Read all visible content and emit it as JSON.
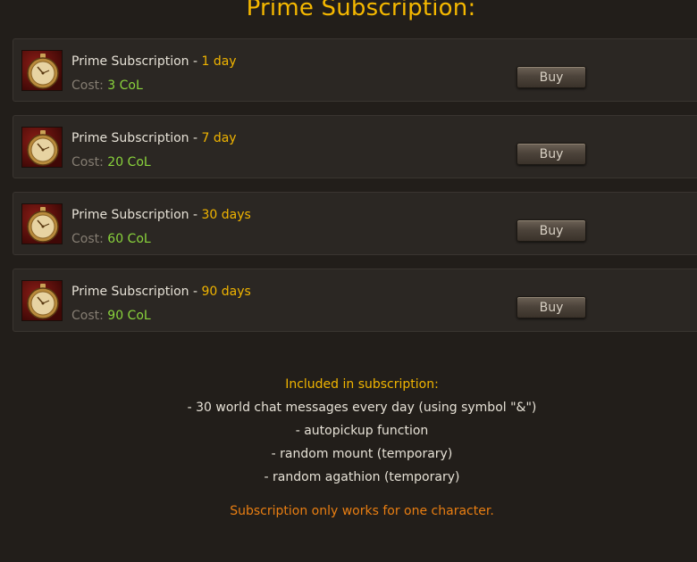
{
  "page": {
    "title": "Prime Subscription:"
  },
  "items": [
    {
      "name": "Prime Subscription - ",
      "duration": "1 day",
      "cost_label": "Cost: ",
      "cost_value": "3 CoL",
      "buy_label": "Buy",
      "icon": "pocket-watch-icon"
    },
    {
      "name": "Prime Subscription - ",
      "duration": "7 day",
      "cost_label": "Cost: ",
      "cost_value": "20 CoL",
      "buy_label": "Buy",
      "icon": "pocket-watch-icon"
    },
    {
      "name": "Prime Subscription - ",
      "duration": "30 days",
      "cost_label": "Cost: ",
      "cost_value": "60 CoL",
      "buy_label": "Buy",
      "icon": "pocket-watch-icon"
    },
    {
      "name": "Prime Subscription - ",
      "duration": "90 days",
      "cost_label": "Cost: ",
      "cost_value": "90 CoL",
      "buy_label": "Buy",
      "icon": "pocket-watch-icon"
    }
  ],
  "info": {
    "heading": "Included in subscription:",
    "features": [
      "- 30 world chat messages every day (using symbol \"&\")",
      "- autopickup function",
      "- random mount (temporary)",
      "- random agathion (temporary)"
    ],
    "note": "Subscription only works for one character."
  },
  "colors": {
    "background": "#221e1a",
    "row": "#2b2723",
    "gold": "#f0b400",
    "green": "#8ad43c",
    "orange": "#e87e12",
    "text": "#e6e1d6",
    "muted": "#857d72"
  }
}
